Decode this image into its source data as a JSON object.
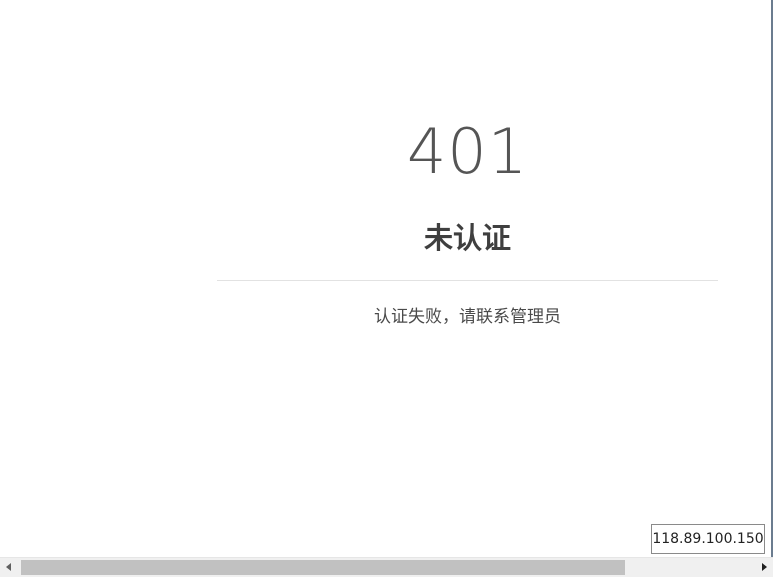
{
  "error": {
    "code": "401",
    "title": "未认证",
    "message": "认证失败，请联系管理员"
  },
  "tooltip": {
    "ip": "118.89.100.150"
  },
  "scrollbar": {
    "left_icon": "chevron-left-icon",
    "right_icon": "chevron-right-icon"
  },
  "colors": {
    "code": "#555555",
    "title": "#3f3f3f",
    "divider": "#e2e2e2",
    "scroll_thumb": "#c1c1c1",
    "scroll_track": "#f0f0f0"
  }
}
